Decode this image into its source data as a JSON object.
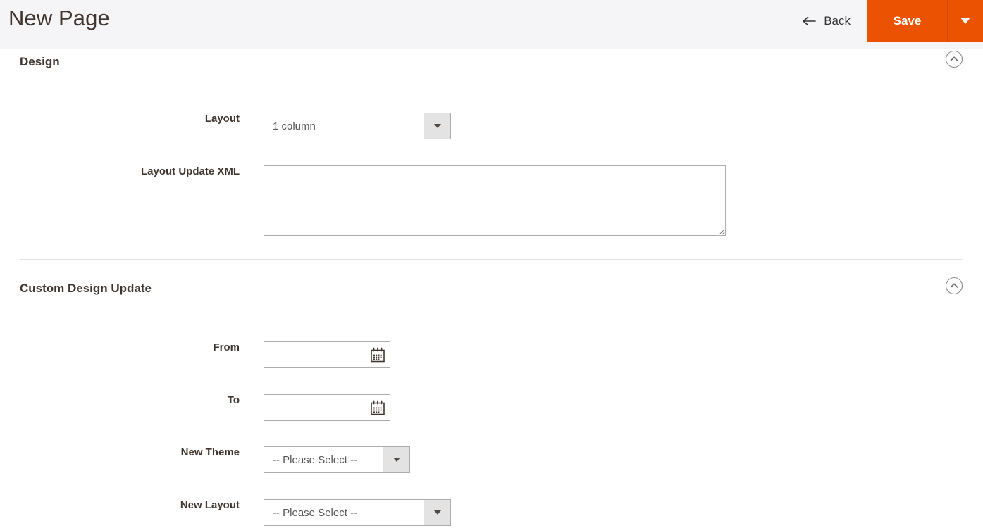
{
  "header": {
    "title": "New Page",
    "back_label": "Back",
    "back_icon": "arrow-left-icon",
    "save_label": "Save",
    "save_toggle_icon": "caret-down-icon",
    "accent_color": "#eb5202",
    "background_color": "#f5f4f6"
  },
  "sections": [
    {
      "title": "Design",
      "collapse_icon": "chevron-up-circle-icon",
      "fields": {
        "layout": {
          "label": "Layout",
          "value": "1 column",
          "arrow_icon": "caret-down-icon"
        },
        "layout_update_xml": {
          "label": "Layout Update XML",
          "value": "",
          "placeholder": ""
        }
      }
    },
    {
      "title": "Custom Design Update",
      "collapse_icon": "chevron-up-circle-icon",
      "fields": {
        "from": {
          "label": "From",
          "value": "",
          "placeholder": "",
          "icon": "calendar-icon"
        },
        "to": {
          "label": "To",
          "value": "",
          "placeholder": "",
          "icon": "calendar-icon"
        },
        "new_theme": {
          "label": "New Theme",
          "value": "-- Please Select --",
          "arrow_icon": "caret-down-icon"
        },
        "new_layout": {
          "label": "New Layout",
          "value": "-- Please Select --",
          "arrow_icon": "caret-down-icon"
        }
      }
    }
  ]
}
